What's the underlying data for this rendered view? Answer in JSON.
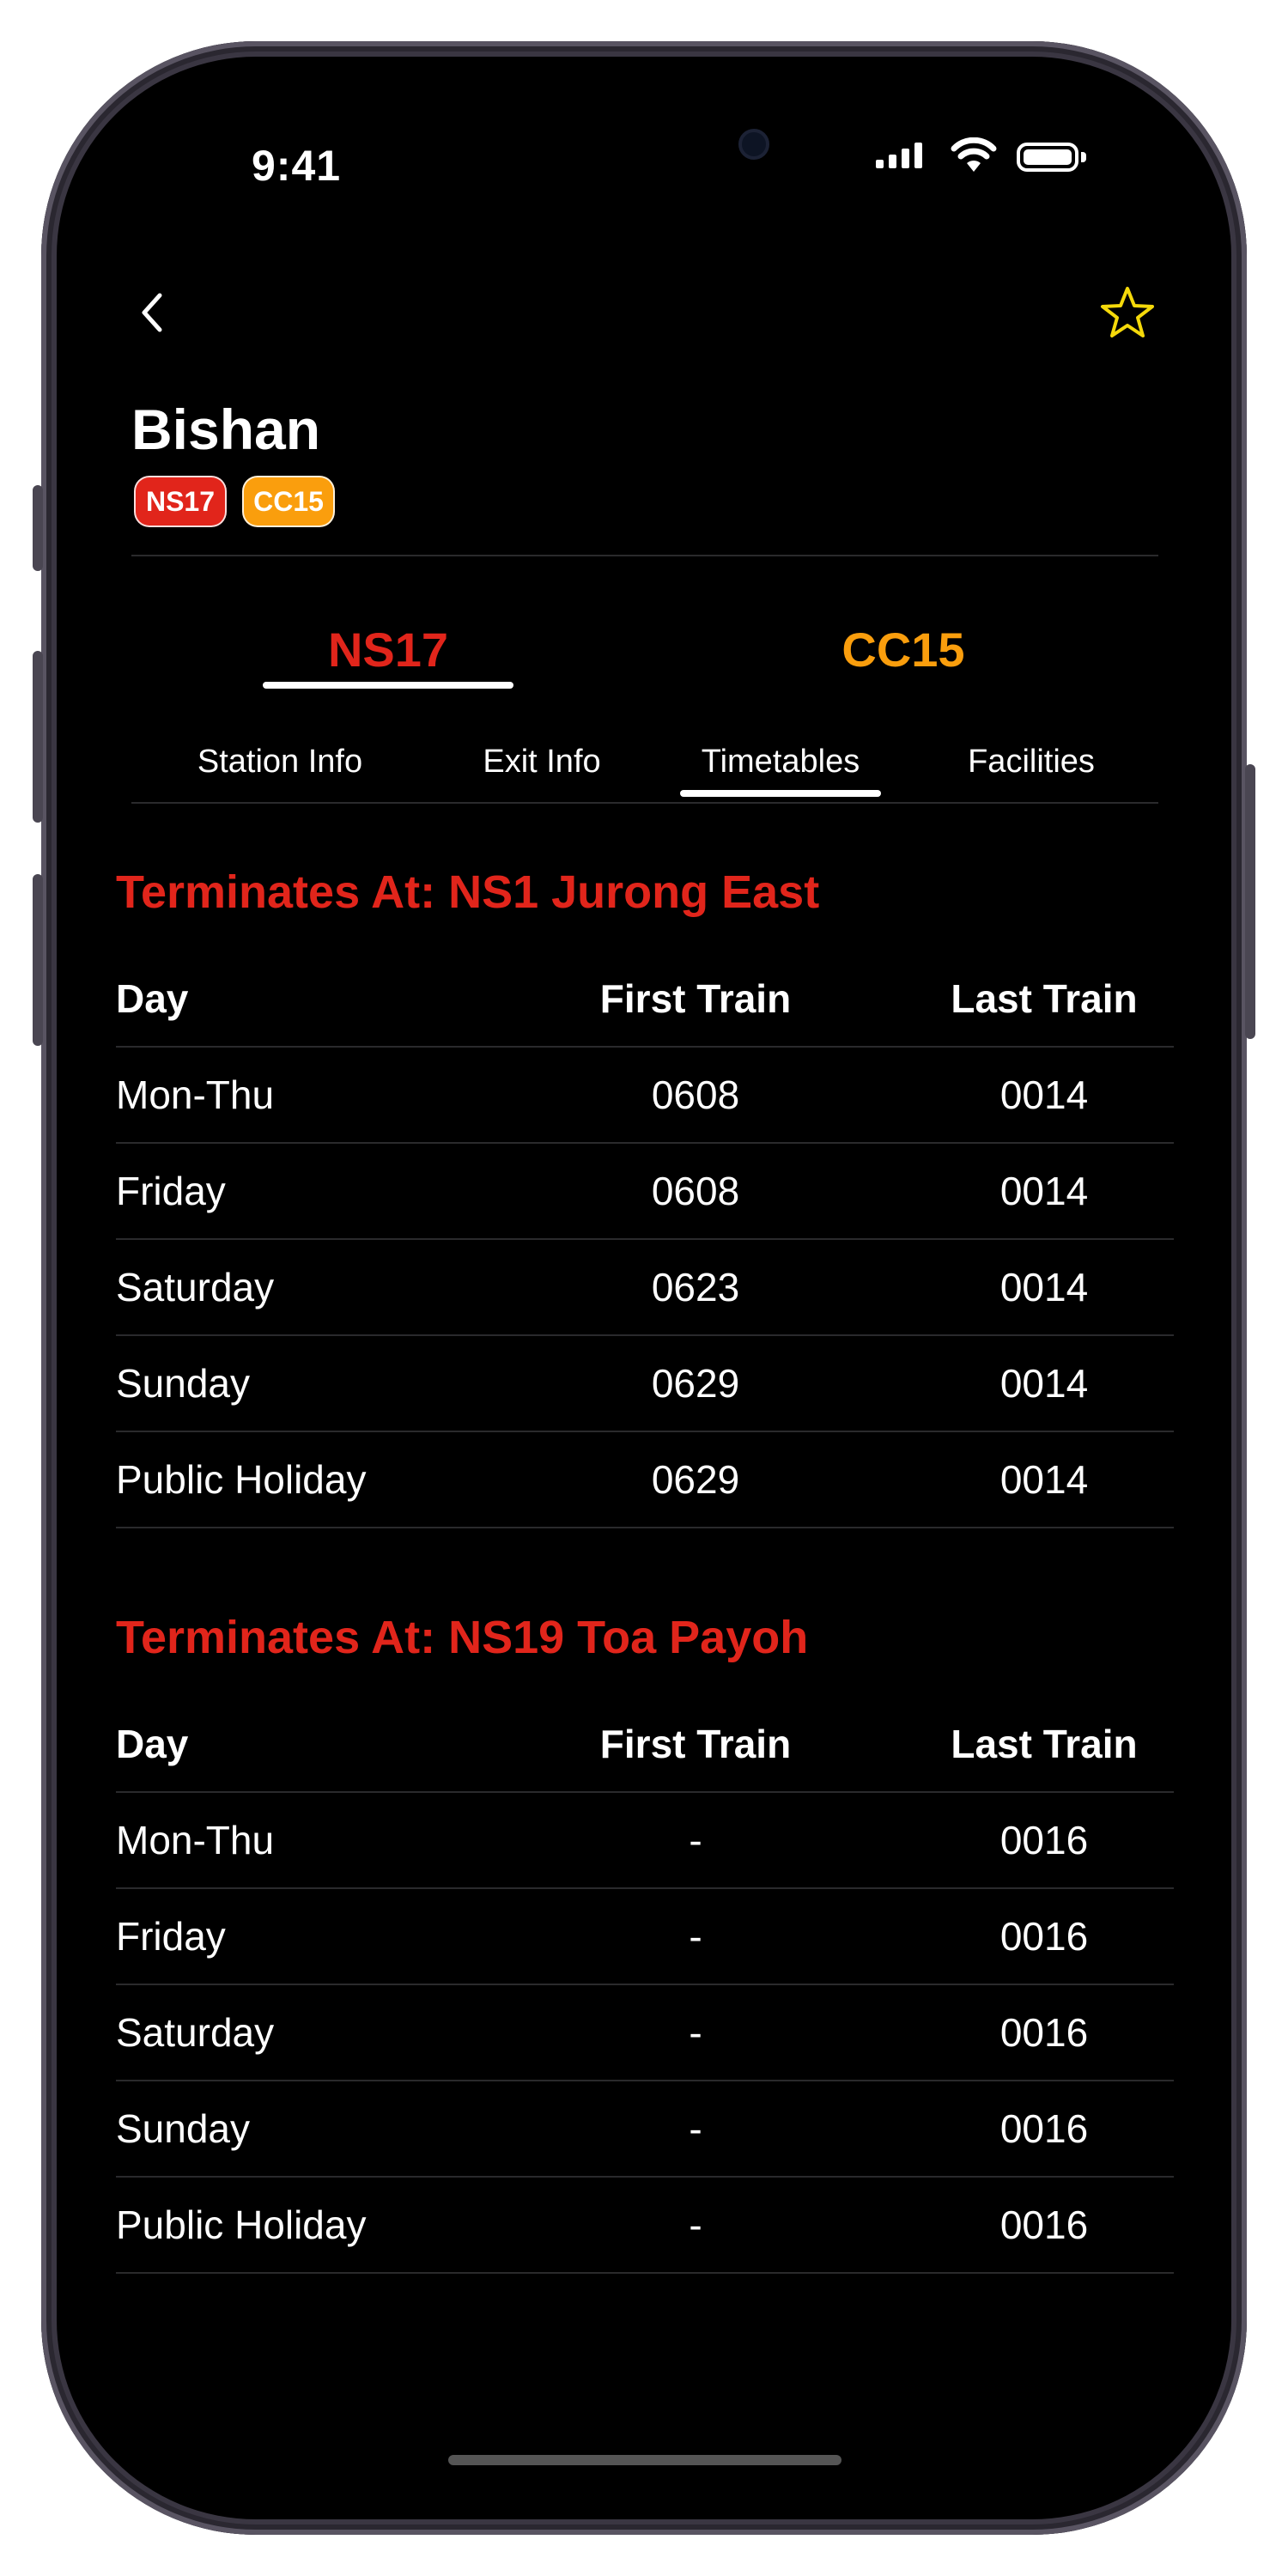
{
  "status_bar": {
    "time": "9:41"
  },
  "header": {
    "station_name": "Bishan",
    "back_icon": "chevron-left-icon",
    "favorite_icon": "star-outline-icon"
  },
  "badges": [
    {
      "code": "NS17",
      "color": "#e1251b"
    },
    {
      "code": "CC15",
      "color": "#fa9e0d"
    }
  ],
  "line_tabs": [
    {
      "label": "NS17",
      "color": "#e1251b",
      "active": true
    },
    {
      "label": "CC15",
      "color": "#fa9e0d",
      "active": false
    }
  ],
  "sub_tabs": [
    {
      "label": "Station Info",
      "active": false
    },
    {
      "label": "Exit Info",
      "active": false
    },
    {
      "label": "Timetables",
      "active": true
    },
    {
      "label": "Facilities",
      "active": false
    }
  ],
  "timetables": [
    {
      "title": "Terminates At: NS1 Jurong East",
      "headers": {
        "day": "Day",
        "first": "First Train",
        "last": "Last Train"
      },
      "rows": [
        {
          "day": "Mon-Thu",
          "first": "0608",
          "last": "0014"
        },
        {
          "day": "Friday",
          "first": "0608",
          "last": "0014"
        },
        {
          "day": "Saturday",
          "first": "0623",
          "last": "0014"
        },
        {
          "day": "Sunday",
          "first": "0629",
          "last": "0014"
        },
        {
          "day": "Public Holiday",
          "first": "0629",
          "last": "0014"
        }
      ]
    },
    {
      "title": "Terminates At: NS19 Toa Payoh",
      "headers": {
        "day": "Day",
        "first": "First Train",
        "last": "Last Train"
      },
      "rows": [
        {
          "day": "Mon-Thu",
          "first": "-",
          "last": "0016"
        },
        {
          "day": "Friday",
          "first": "-",
          "last": "0016"
        },
        {
          "day": "Saturday",
          "first": "-",
          "last": "0016"
        },
        {
          "day": "Sunday",
          "first": "-",
          "last": "0016"
        },
        {
          "day": "Public Holiday",
          "first": "-",
          "last": "0016"
        }
      ]
    }
  ],
  "colors": {
    "ns_line": "#e1251b",
    "cc_line": "#fa9e0d",
    "star": "#f5d90a"
  }
}
